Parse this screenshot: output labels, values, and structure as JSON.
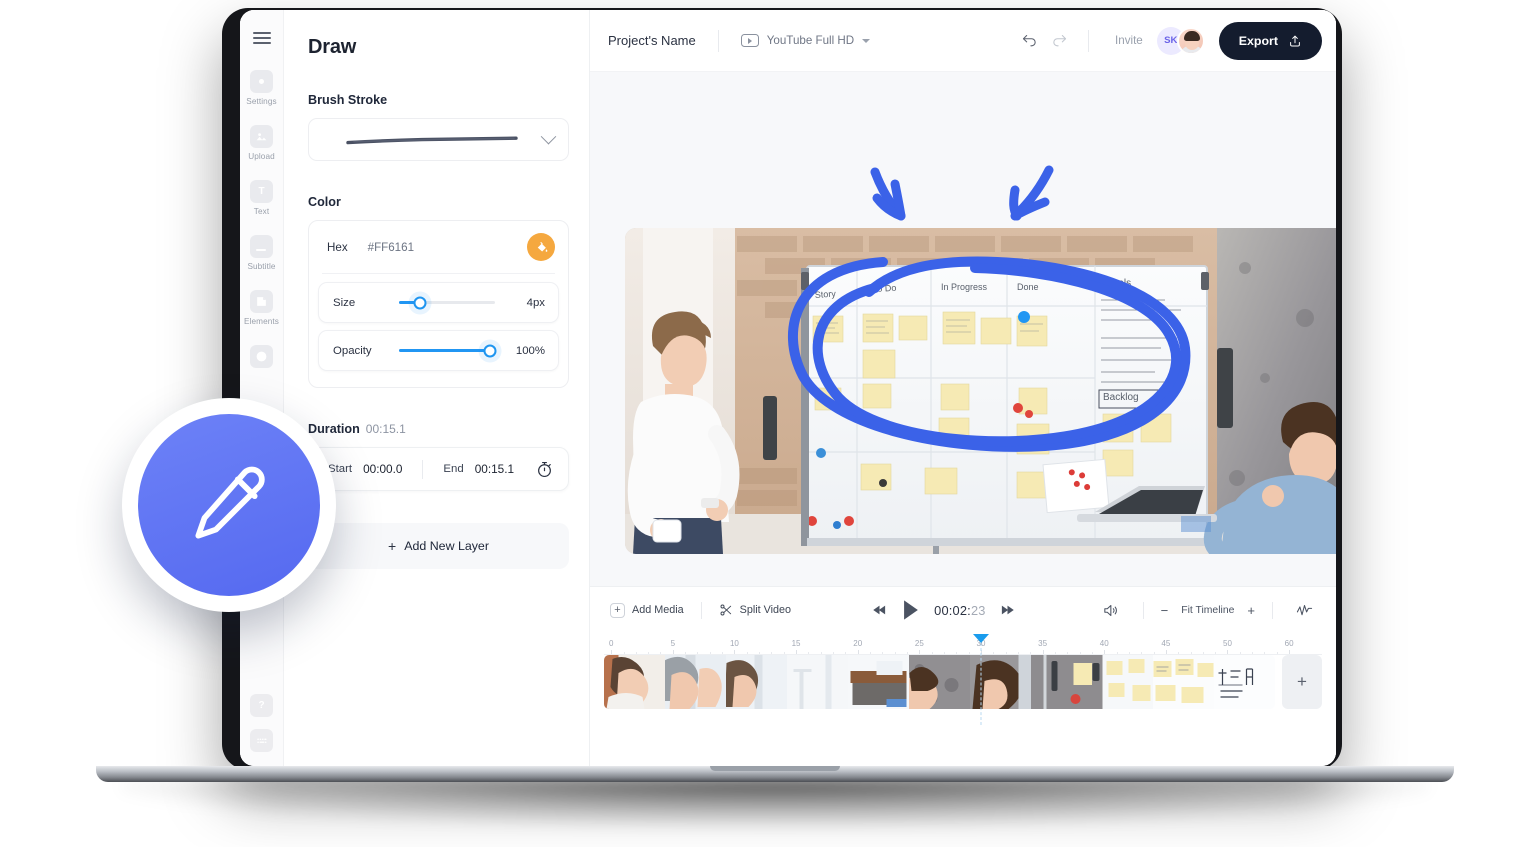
{
  "rail": {
    "menu_icon": "hamburger-icon",
    "items": [
      {
        "label": "Settings",
        "icon": "settings-icon"
      },
      {
        "label": "Upload",
        "icon": "upload-image-icon"
      },
      {
        "label": "Text",
        "icon": "text-icon"
      },
      {
        "label": "Subtitle",
        "icon": "subtitle-icon"
      },
      {
        "label": "Elements",
        "icon": "elements-icon"
      }
    ],
    "bottom": [
      {
        "label": "Help",
        "icon": "help-icon"
      },
      {
        "label": "Keyboard shortcuts",
        "icon": "keyboard-icon"
      }
    ]
  },
  "panel": {
    "title": "Draw",
    "brush": {
      "label": "Brush Stroke",
      "selected": "stroke-preview",
      "chevron": "chevron-down-icon"
    },
    "color": {
      "label": "Color",
      "hex_key": "Hex",
      "hex_value": "#FF6161",
      "bucket_icon": "paint-bucket-icon",
      "bucket_color": "#F5A83F",
      "sliders": [
        {
          "name": "Size",
          "value": "4px",
          "percent": 22
        },
        {
          "name": "Opacity",
          "value": "100%",
          "percent": 95
        }
      ]
    },
    "duration": {
      "label": "Duration",
      "value": "00:15.1",
      "start_key": "Start",
      "start_value": "00:00.0",
      "end_key": "End",
      "end_value": "00:15.1",
      "timer_icon": "stopwatch-icon"
    },
    "add_layer": {
      "label": "Add New Layer",
      "plus": "+"
    }
  },
  "header": {
    "project_name": "Project's Name",
    "preset_label": "YouTube Full HD",
    "preset_icon": "youtube-icon",
    "undo_icon": "undo-icon",
    "redo_icon": "redo-icon",
    "invite_label": "Invite",
    "avatars": [
      {
        "initials": "SK",
        "type": "initials"
      },
      {
        "initials": "",
        "type": "photo"
      }
    ],
    "export_label": "Export",
    "export_icon": "share-upload-icon",
    "export_bg": "#141C2E"
  },
  "canvas": {
    "annotations": {
      "color": "#3B62E8",
      "shapes": [
        "arrow-down-left",
        "arrow-down-left-2",
        "ellipse-circle"
      ]
    }
  },
  "timeline": {
    "add_media": {
      "label": "Add Media",
      "icon": "plus-box-icon"
    },
    "split_video": {
      "label": "Split Video",
      "icon": "scissors-icon"
    },
    "transport": {
      "rewind_icon": "rewind-icon",
      "play_icon": "play-icon",
      "forward_icon": "fast-forward-icon",
      "time_main": "00:02:",
      "time_frames": "23"
    },
    "volume_icon": "volume-icon",
    "zoom": {
      "minus": "−",
      "label": "Fit Timeline",
      "plus": "+"
    },
    "waveform_icon": "waveform-icon",
    "ruler": {
      "labels": [
        0,
        5,
        10,
        15,
        20,
        25,
        30,
        35,
        40,
        45,
        50,
        60
      ],
      "minor_per_major": 5,
      "playhead_at": 30
    },
    "strip_add": {
      "label": "+"
    }
  }
}
